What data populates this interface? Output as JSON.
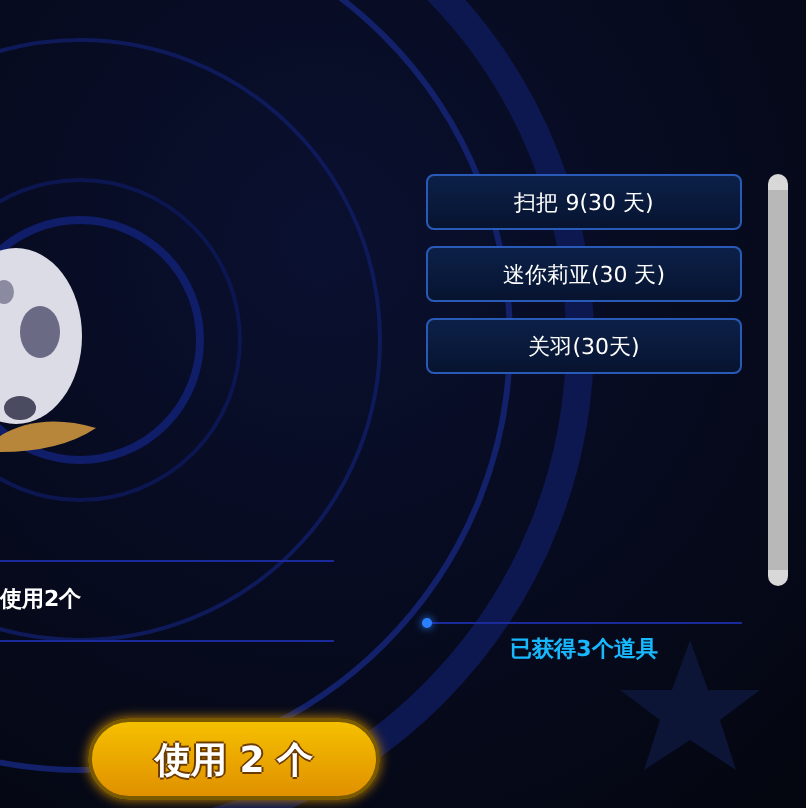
{
  "items": [
    {
      "label": "扫把 9(30 天)"
    },
    {
      "label": "迷你莉亚(30 天)"
    },
    {
      "label": "关羽(30天)"
    }
  ],
  "use_note": "使用2个",
  "summary": "已获得3个道具",
  "use_button": "使用 2 个"
}
